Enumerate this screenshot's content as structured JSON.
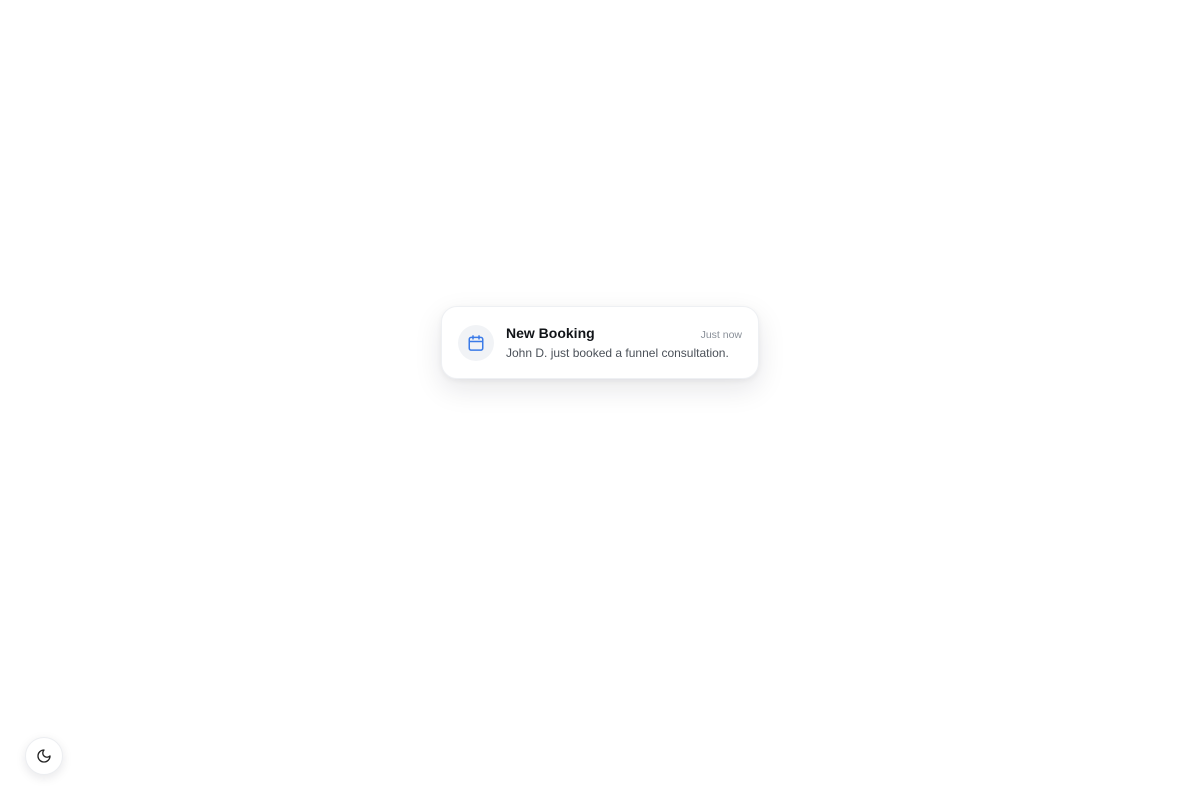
{
  "notification": {
    "icon": "calendar-icon",
    "title": "New Booking",
    "time": "Just now",
    "message": "John D. just booked a funnel consultation.",
    "accent_color": "#3b7be8"
  },
  "theme_toggle": {
    "icon": "moon-icon"
  }
}
